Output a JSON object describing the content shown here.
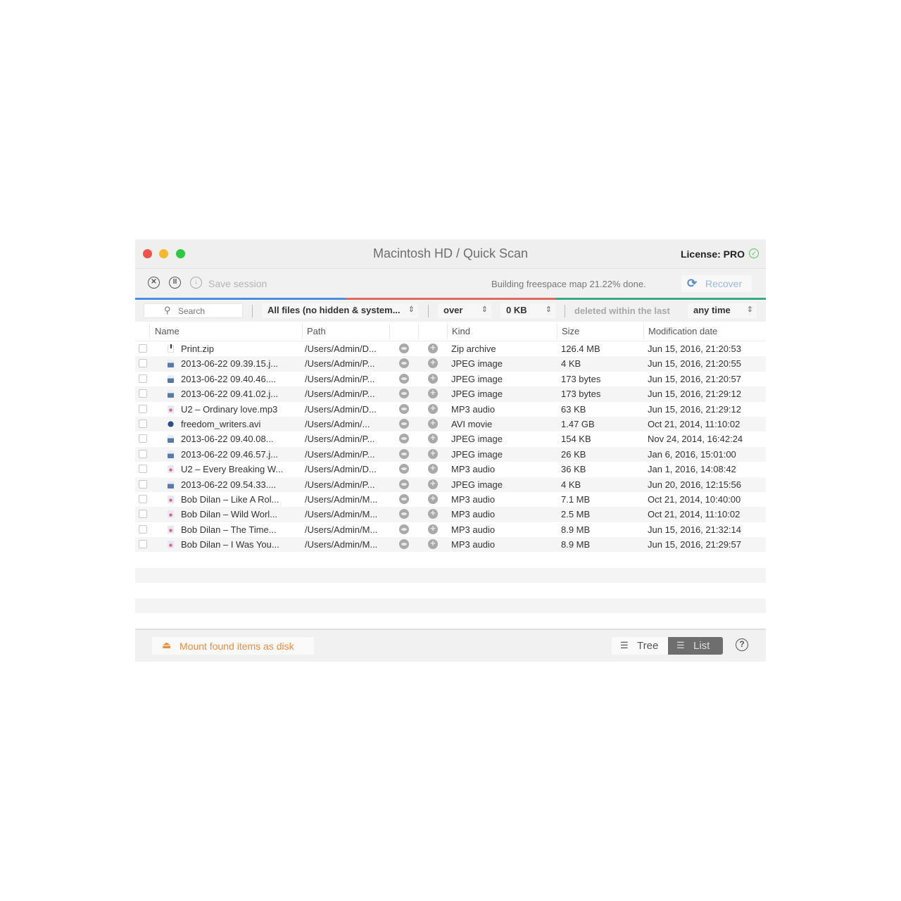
{
  "window": {
    "title": "Macintosh HD / Quick Scan",
    "license_label": "License: PRO",
    "license_icon": "check-circle-icon"
  },
  "toolbar": {
    "stop_icon": "stop-circle-icon",
    "pause_icon": "pause-circle-icon",
    "save_icon": "download-circle-icon",
    "save_label": "Save session",
    "status_text": "Building freespace map 21.22% done.",
    "recover_label": "Recover",
    "recover_icon": "refresh-icon"
  },
  "progress": {
    "percent_done": 21.22,
    "segment_colors": [
      "#4a8ede",
      "#e06a60",
      "#3aa886"
    ]
  },
  "filters": {
    "search_placeholder": "Search",
    "file_type": "All files (no hidden & system...",
    "size_comparator": "over",
    "size_value": "0 KB",
    "deleted_label": "deleted within the last",
    "time_range": "any time"
  },
  "table": {
    "columns": [
      "Name",
      "Path",
      "",
      "",
      "Kind",
      "Size",
      "Modification date"
    ],
    "rows": [
      {
        "type": "zip",
        "name": "Print.zip",
        "path": "/Users/Admin/D...",
        "kind": "Zip archive",
        "size": "126.4 MB",
        "date": "Jun 15, 2016, 21:20:53"
      },
      {
        "type": "jpeg",
        "name": "2013-06-22 09.39.15.j...",
        "path": "/Users/Admin/P...",
        "kind": "JPEG image",
        "size": "4 KB",
        "date": "Jun 15, 2016, 21:20:55"
      },
      {
        "type": "jpeg",
        "name": "2013-06-22 09.40.46....",
        "path": "/Users/Admin/P...",
        "kind": "JPEG image",
        "size": "173 bytes",
        "date": "Jun 15, 2016, 21:20:57"
      },
      {
        "type": "jpeg",
        "name": "2013-06-22 09.41.02.j...",
        "path": "/Users/Admin/P...",
        "kind": "JPEG image",
        "size": "173 bytes",
        "date": "Jun 15, 2016, 21:29:12"
      },
      {
        "type": "mp3",
        "name": "U2 – Ordinary love.mp3",
        "path": "/Users/Admin/D...",
        "kind": "MP3 audio",
        "size": "63 KB",
        "date": "Jun 15, 2016, 21:29:12"
      },
      {
        "type": "avi",
        "name": "freedom_writers.avi",
        "path": "/Users/Admin/...",
        "kind": "AVI movie",
        "size": "1.47 GB",
        "date": "Oct 21, 2014, 11:10:02"
      },
      {
        "type": "jpeg",
        "name": "2013-06-22 09.40.08...",
        "path": "/Users/Admin/P...",
        "kind": "JPEG image",
        "size": "154 KB",
        "date": "Nov 24, 2014, 16:42:24"
      },
      {
        "type": "jpeg",
        "name": "2013-06-22 09.46.57.j...",
        "path": "/Users/Admin/P...",
        "kind": "JPEG image",
        "size": "26 KB",
        "date": "Jan 6, 2016, 15:01:00"
      },
      {
        "type": "mp3",
        "name": "U2 – Every Breaking W...",
        "path": "/Users/Admin/D...",
        "kind": "MP3 audio",
        "size": "36 KB",
        "date": "Jan 1, 2016, 14:08:42"
      },
      {
        "type": "jpeg",
        "name": "2013-06-22 09.54.33....",
        "path": "/Users/Admin/P...",
        "kind": "JPEG image",
        "size": "4 KB",
        "date": "Jun 20, 2016, 12:15:56"
      },
      {
        "type": "mp3",
        "name": "Bob Dilan – Like A Rol...",
        "path": "/Users/Admin/M...",
        "kind": "MP3 audio",
        "size": "7.1 MB",
        "date": "Oct 21, 2014, 10:40:00"
      },
      {
        "type": "mp3",
        "name": "Bob Dilan – Wild Worl...",
        "path": "/Users/Admin/M...",
        "kind": "MP3 audio",
        "size": "2.5 MB",
        "date": "Oct 21, 2014, 11:10:02"
      },
      {
        "type": "mp3",
        "name": "Bob Dilan – The Time...",
        "path": "/Users/Admin/M...",
        "kind": "MP3 audio",
        "size": "8.9 MB",
        "date": "Jun 15, 2016, 21:32:14"
      },
      {
        "type": "mp3",
        "name": "Bob Dilan – I Was You...",
        "path": "/Users/Admin/M...",
        "kind": "MP3 audio",
        "size": "8.9 MB",
        "date": "Jun 15, 2016, 21:29:57"
      }
    ]
  },
  "bottombar": {
    "mount_label": "Mount found items as disk",
    "mount_icon": "disk-mount-icon",
    "view_tree_label": "Tree",
    "view_list_label": "List",
    "active_view": "List",
    "help_icon": "help-icon"
  }
}
